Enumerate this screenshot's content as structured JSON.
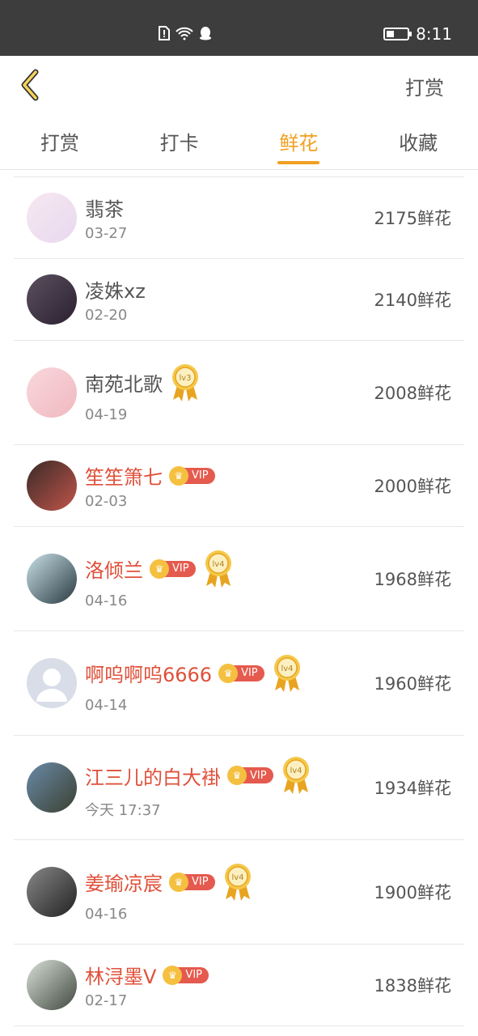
{
  "status_bar": {
    "time": "8:11"
  },
  "header": {
    "action": "打赏"
  },
  "tabs": [
    {
      "label": "打赏",
      "active": false
    },
    {
      "label": "打卡",
      "active": false
    },
    {
      "label": "鲜花",
      "active": true
    },
    {
      "label": "收藏",
      "active": false
    }
  ],
  "rows": [
    {
      "name": "翡茶",
      "date": "03-27",
      "amount": "2175鲜花",
      "vip": false,
      "level": ""
    },
    {
      "name": "凌姝xz",
      "date": "02-20",
      "amount": "2140鲜花",
      "vip": false,
      "level": ""
    },
    {
      "name": "南苑北歌",
      "date": "04-19",
      "amount": "2008鲜花",
      "vip": false,
      "level": "lv3"
    },
    {
      "name": "笙笙箫七",
      "date": "02-03",
      "amount": "2000鲜花",
      "vip": true,
      "level": ""
    },
    {
      "name": "洛倾兰",
      "date": "04-16",
      "amount": "1968鲜花",
      "vip": true,
      "level": "lv4"
    },
    {
      "name": "啊呜啊呜6666",
      "date": "04-14",
      "amount": "1960鲜花",
      "vip": true,
      "level": "lv4"
    },
    {
      "name": "江三儿的白大褂",
      "date": "今天 17:37",
      "amount": "1934鲜花",
      "vip": true,
      "level": "lv4"
    },
    {
      "name": "姜瑜凉宸",
      "date": "04-16",
      "amount": "1900鲜花",
      "vip": true,
      "level": "lv4"
    },
    {
      "name": "林浔墨V",
      "date": "02-17",
      "amount": "1838鲜花",
      "vip": true,
      "level": ""
    }
  ],
  "vip_label": "VIP",
  "colors": {
    "accent": "#f0a020",
    "vip_name": "#e0503a"
  }
}
